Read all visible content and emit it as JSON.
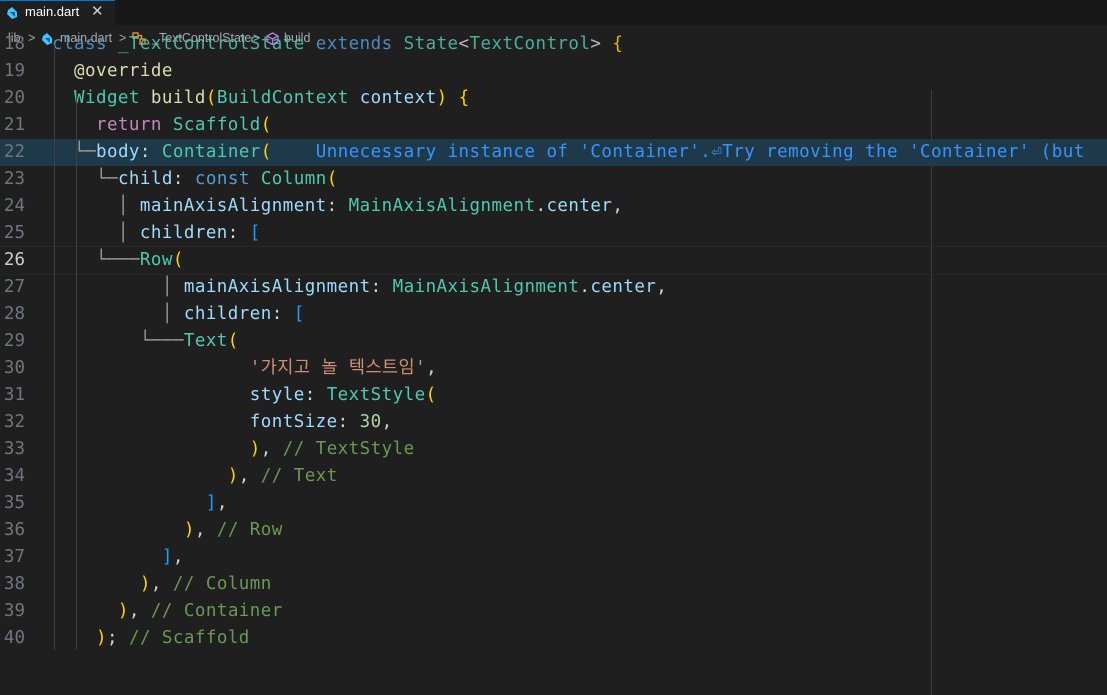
{
  "tab": {
    "label": "main.dart",
    "close": "✕"
  },
  "breadcrumb": {
    "items": [
      "lib",
      "main.dart",
      "_TextControlState",
      "build"
    ],
    "sep": ">"
  },
  "editor": {
    "lines": [
      {
        "num": "18",
        "text": "class _TextControlState extends State<TextControl> {"
      },
      {
        "num": "19",
        "text": "@override"
      },
      {
        "num": "20",
        "text": "Widget build(BuildContext context) {"
      },
      {
        "num": "21",
        "text": "return Scaffold("
      },
      {
        "num": "22",
        "text": "body: Container(",
        "diagnostic": "Unnecessary instance of 'Container'.⏎Try removing the 'Container' (but"
      },
      {
        "num": "23",
        "text": "child: const Column("
      },
      {
        "num": "24",
        "text": "mainAxisAlignment: MainAxisAlignment.center,"
      },
      {
        "num": "25",
        "text": "children: ["
      },
      {
        "num": "26",
        "text": "Row("
      },
      {
        "num": "27",
        "text": "mainAxisAlignment: MainAxisAlignment.center,"
      },
      {
        "num": "28",
        "text": "children: ["
      },
      {
        "num": "29",
        "text": "Text("
      },
      {
        "num": "30",
        "text": "'가지고 놀 텍스트임',"
      },
      {
        "num": "31",
        "text": "style: TextStyle("
      },
      {
        "num": "32",
        "text": "fontSize: 30,"
      },
      {
        "num": "33",
        "text": "), // TextStyle"
      },
      {
        "num": "34",
        "text": "), // Text"
      },
      {
        "num": "35",
        "text": "],"
      },
      {
        "num": "36",
        "text": "), // Row"
      },
      {
        "num": "37",
        "text": "],"
      },
      {
        "num": "38",
        "text": "), // Column"
      },
      {
        "num": "39",
        "text": "), // Container"
      },
      {
        "num": "40",
        "text": "); // Scaffold"
      }
    ],
    "active_line": "26",
    "highlighted_line": "22"
  },
  "colors": {
    "background": "#1f1f1f",
    "keyword": "#569cd6",
    "control": "#c586c0",
    "type": "#4ec9b0",
    "function": "#dcdcaa",
    "variable": "#9cdcfe",
    "string": "#ce9178",
    "number": "#b5cea8",
    "comment": "#6a9955",
    "diagnostic": "#3794ff"
  }
}
